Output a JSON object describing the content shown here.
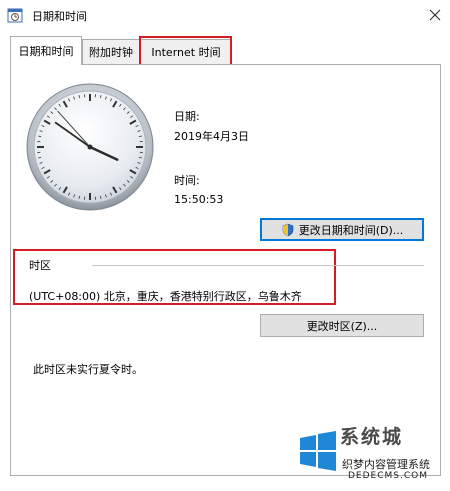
{
  "window": {
    "title": "日期和时间"
  },
  "tabs": [
    {
      "label": "日期和时间"
    },
    {
      "label": "附加时钟"
    },
    {
      "label": "Internet 时间"
    }
  ],
  "date": {
    "label": "日期:",
    "value": "2019年4月3日"
  },
  "time": {
    "label": "时间:",
    "value": "15:50:53"
  },
  "buttons": {
    "change_datetime": "更改日期和时间(D)...",
    "change_timezone": "更改时区(Z)..."
  },
  "timezone": {
    "header": "时区",
    "value": "(UTC+08:00) 北京，重庆，香港特别行政区，乌鲁木齐"
  },
  "dst_note": "此时区未实行夏令时。",
  "watermark": {
    "brand": "系统城",
    "tagline": "织梦内容管理系统",
    "url": "DEDECMS.COM"
  },
  "colors": {
    "highlight": "#d21d24",
    "accent": "#0078d7"
  },
  "clock": {
    "hours": 15,
    "minutes": 50,
    "seconds": 53
  }
}
